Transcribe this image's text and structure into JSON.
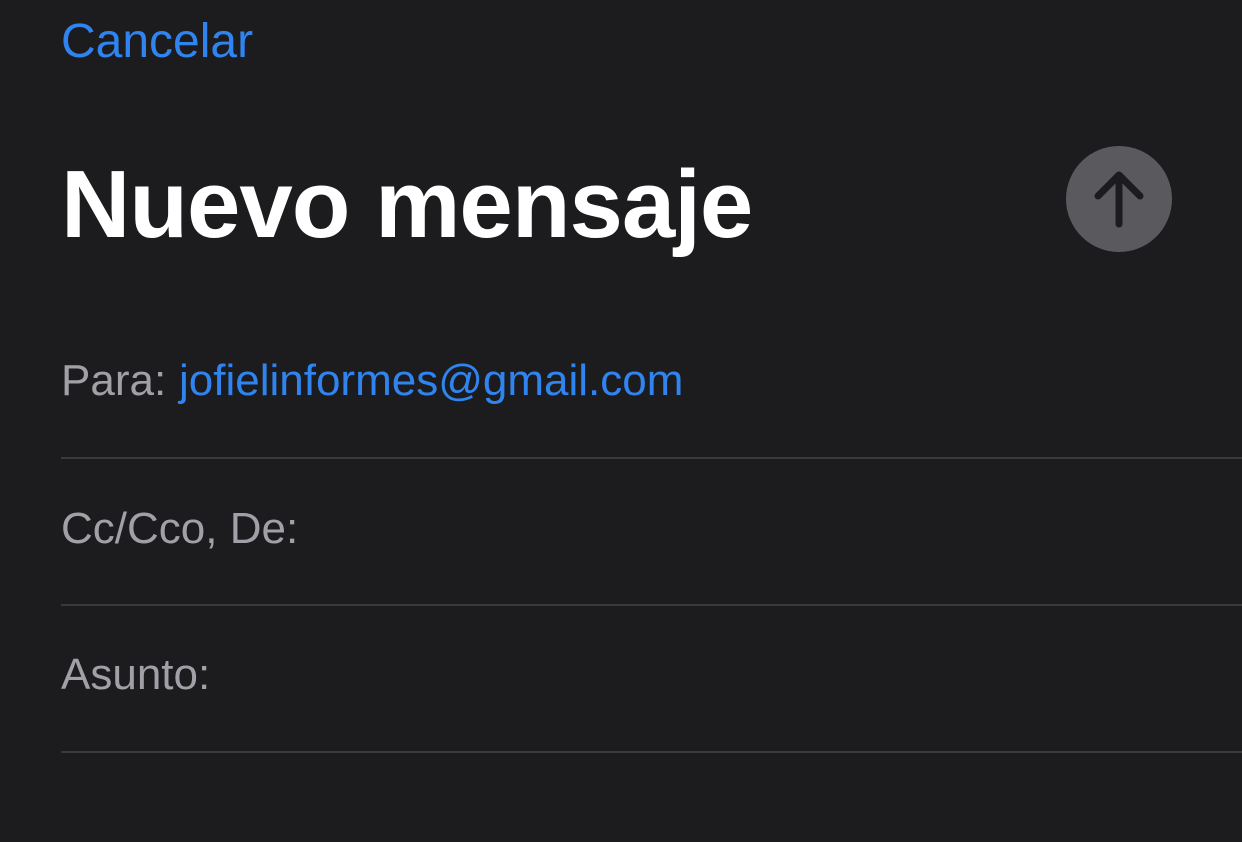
{
  "header": {
    "cancel_label": "Cancelar",
    "title": "Nuevo mensaje",
    "send_icon": "arrow-up-icon"
  },
  "fields": {
    "to": {
      "label": "Para:",
      "recipient": "jofielinformes@gmail.com"
    },
    "cc_from": {
      "label": "Cc/Cco, De:",
      "value": ""
    },
    "subject": {
      "label": "Asunto:",
      "value": ""
    }
  },
  "colors": {
    "background": "#1c1c1e",
    "accent": "#2f84f0",
    "label": "#a0a0a6",
    "separator": "#3a3a3c",
    "send_button": "#5a595e"
  }
}
